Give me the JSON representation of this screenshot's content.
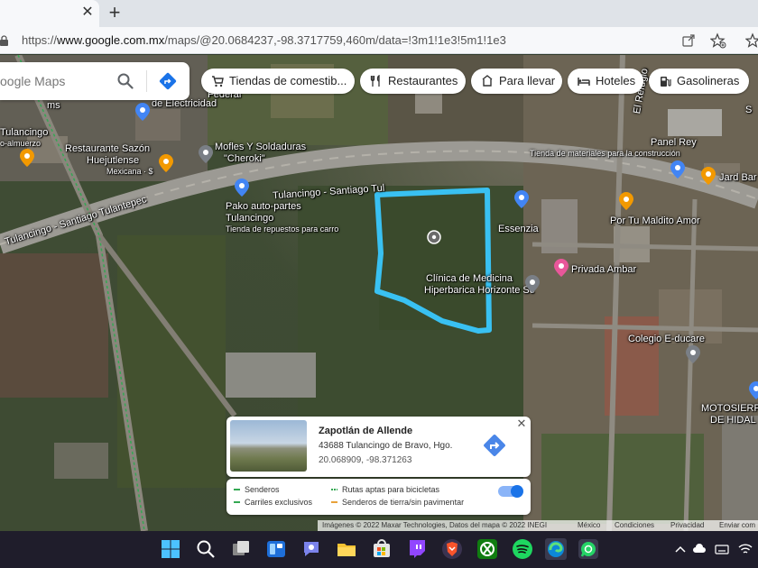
{
  "browser": {
    "tab_close": "✕",
    "new_tab": "+",
    "url_prefix": "https://",
    "url_host": "www.google.com.mx",
    "url_path": "/maps/@20.0684237,-98.3717759,460m/data=!3m1!1e3!5m1!1e3"
  },
  "search": {
    "placeholder": "oogle Maps"
  },
  "chips": [
    {
      "label": "Tiendas de comestib...",
      "icon": "cart-icon"
    },
    {
      "label": "Restaurantes",
      "icon": "fork-knife-icon"
    },
    {
      "label": "Para llevar",
      "icon": "takeout-icon"
    },
    {
      "label": "Hoteles",
      "icon": "bed-icon"
    },
    {
      "label": "Gasolineras",
      "icon": "fuel-icon"
    }
  ],
  "map_labels": {
    "federal": "Federal",
    "electricidad": "de Electricidad",
    "tulancingo_left": "Tulancingo",
    "almuerzo": "o-almuerzo",
    "ms": "ms",
    "restaurante_1": "Restaurante Sazón",
    "restaurante_2": "Huejutlense",
    "restaurante_3": "Mexicana · $",
    "mofles_1": "Mofles Y Soldaduras",
    "mofles_2": "\"Cheroki\"",
    "refugio": "El Refugio",
    "panel_rey": "Panel Rey",
    "tienda_materiales": "Tienda de materiales para la construcción",
    "jard": "Jard Bar",
    "s_right": "S",
    "road_top": "Tulancingo - Santiago Tul",
    "road_left": "Tulancingo - Santiago Tulantepec",
    "pako_1": "Pako auto-partes",
    "pako_2": "Tulancingo",
    "pako_3": "Tienda de repuestos para carro",
    "essenzia": "Essenzia",
    "maldito_amor": "Por Tu Maldito Amor",
    "privada_ambar": "Privada Ambar",
    "clinica_1": "Clínica de Medicina",
    "clinica_2": "Hiperbarica Horizonte Sc",
    "colegio": "Colegio E-ducare",
    "moto_1": "MOTOSIERR",
    "moto_2": "DE HIDAL"
  },
  "info_card": {
    "name": "Zapotlán de Allende",
    "address": "43688 Tulancingo de Bravo, Hgo.",
    "coords": "20.068909, -98.371263",
    "close": "✕"
  },
  "legend": {
    "senderos": "Senderos",
    "rutas": "Rutas aptas para bicicletas",
    "carriles": "Carriles exclusivos",
    "tierra": "Senderos de tierra/sin pavimentar",
    "toggle_on": true,
    "colors": {
      "senderos": "#34a853",
      "rutas": "#34a853",
      "carriles": "#34a853",
      "tierra": "#e8a23a"
    }
  },
  "attribution": {
    "imagery": "Imágenes © 2022 Maxar Technologies, Datos del mapa © 2022 INEGI",
    "country": "México",
    "terms": "Condiciones",
    "privacy": "Privacidad",
    "feedback": "Enviar com"
  },
  "colors": {
    "parcel_outline": "#39c1f2",
    "google_blue": "#1a73e8"
  },
  "taskbar_icons": [
    "windows-start-icon",
    "search-icon",
    "task-view-icon",
    "widgets-icon",
    "chat-icon",
    "file-explorer-icon",
    "store-icon",
    "twitch-icon",
    "brave-icon",
    "xbox-icon",
    "spotify-icon",
    "edge-icon",
    "whatsapp-icon"
  ]
}
